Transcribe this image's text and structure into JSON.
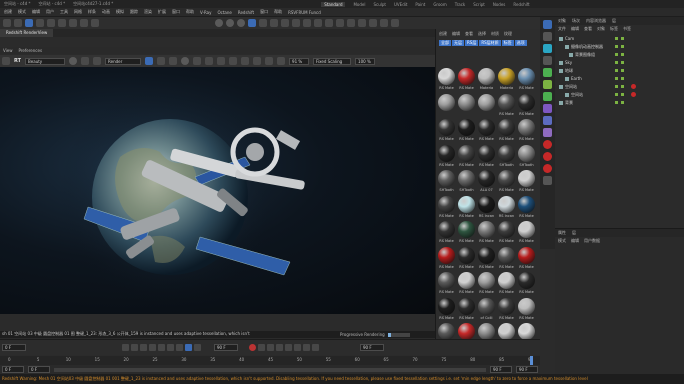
{
  "titlebar": {
    "tabs": [
      "空间站 - c4d *",
      "空间站 - c4d *",
      "空间站c4d27-1.c4d *"
    ],
    "active_layout": "Standard",
    "layouts": [
      "Model",
      "Sculpt",
      "UVEdit",
      "Paint",
      "Groom",
      "Track",
      "Script",
      "Nodes",
      "Redshift"
    ]
  },
  "menubar": {
    "items": [
      "创建",
      "模式",
      "编辑",
      "用户",
      "工具",
      "网格",
      "样条",
      "动画",
      "模拟",
      "跟踪",
      "渲染",
      "扩展",
      "窗口",
      "帮助",
      "V-Ray",
      "Octane",
      "Redshift",
      "窗口",
      "帮助",
      "RSVFRUM Funcd"
    ]
  },
  "panel_tab": {
    "label": "Redshift RenderView"
  },
  "view_menu": {
    "items": [
      "View",
      "Preferences"
    ]
  },
  "renderview": {
    "display_mode": "Beauty",
    "render_mode": "Render",
    "zoom": "91 %",
    "fit_mode": "Fixed Scaling",
    "zoom2": "100 %"
  },
  "log_line": "sh 01 空间站 03 中级 圆盘控制器 01 图 整键_1_23: 形态_3_6 公开体_159 is instanced and uses adaptive tessellation, which isn't",
  "progress": {
    "label": "Progressive Rendering",
    "value": 0.15
  },
  "timeline": {
    "start_frame": "0 F",
    "end_frame": "90 F",
    "current_frame": "90 F",
    "ticks": [
      "0",
      "5",
      "10",
      "15",
      "20",
      "25",
      "30",
      "35",
      "40",
      "45",
      "50",
      "55",
      "60",
      "65",
      "70",
      "75",
      "80",
      "85",
      "90"
    ],
    "field1": "0 F",
    "field2": "0 F",
    "field3": "90 F",
    "field4": "90 F"
  },
  "statusbar": "Redshift Warning: Mesh 01 空间站03 中级 圆盘控制器 01 001 整键_1_23 is instanced and uses adaptive tessellation, which isn't supported. Disabling tessellation. If you need tessellation, please use fixed tessellation settings i.e. set 'min edge length' to zero to force a maximum tessellation level",
  "materials": {
    "tabs": [
      "创建",
      "编辑",
      "查看",
      "选择",
      "材质",
      "纹理"
    ],
    "buttons": [
      "全部",
      "无层",
      "RS层",
      "RS层材质",
      "标签",
      "选项"
    ],
    "items": [
      {
        "label": "RS Mate",
        "color": "#d8d8d8"
      },
      {
        "label": "RS Mate",
        "color": "#c62828"
      },
      {
        "label": "Materia",
        "color": "#bdbdbd"
      },
      {
        "label": "Materia",
        "color": "#c9a227"
      },
      {
        "label": "RS Mate",
        "color": "#6a8fb0"
      },
      {
        "label": "",
        "color": "#9e9e9e"
      },
      {
        "label": "",
        "color": "#8d8d8d"
      },
      {
        "label": "",
        "color": "#a0a0a0"
      },
      {
        "label": "RS Mate",
        "color": "#555555"
      },
      {
        "label": "RS Mate",
        "color": "#2a2a2a"
      },
      {
        "label": "RS Mate",
        "color": "#333333"
      },
      {
        "label": "RS Mate",
        "color": "#1e1e1e"
      },
      {
        "label": "RS Mate",
        "color": "#2a2a2a"
      },
      {
        "label": "RS Mate",
        "color": "#3a3a3a"
      },
      {
        "label": "RS Mate",
        "color": "#7a7a7a"
      },
      {
        "label": "RS Mate",
        "color": "#252525"
      },
      {
        "label": "RS Mate",
        "color": "#444444"
      },
      {
        "label": "RS Mate",
        "color": "#2c2c2c"
      },
      {
        "label": "SHTooth",
        "color": "#3e3e3e"
      },
      {
        "label": "SHTooth",
        "color": "#8a8a8a"
      },
      {
        "label": "SHTooth",
        "color": "#5e5e5e"
      },
      {
        "label": "SHTooth",
        "color": "#6c6c6c"
      },
      {
        "label": "ALA 07",
        "color": "#262626"
      },
      {
        "label": "RS Mate",
        "color": "#4a4a4a"
      },
      {
        "label": "RS Mate",
        "color": "#d0d0d0"
      },
      {
        "label": "RS Mate",
        "color": "#444444"
      },
      {
        "label": "RS Mate",
        "color": "#bfe3e8"
      },
      {
        "label": "RS Incan",
        "color": "#1a1a1a"
      },
      {
        "label": "RS Incan",
        "color": "#cfd8dc"
      },
      {
        "label": "RS Mate",
        "color": "#1d4f7a"
      },
      {
        "label": "RS Mate",
        "color": "#333333"
      },
      {
        "label": "RS Mate",
        "color": "#2e5540"
      },
      {
        "label": "RS Mate",
        "color": "#7a7a7a"
      },
      {
        "label": "RS Mate",
        "color": "#3d3d3d"
      },
      {
        "label": "RS Mate",
        "color": "#cfcfcf"
      },
      {
        "label": "RS Mate",
        "color": "#b71c1c"
      },
      {
        "label": "RS Mate",
        "color": "#2a2a2a"
      },
      {
        "label": "RS Mate",
        "color": "#1f1f1f"
      },
      {
        "label": "RS Mate",
        "color": "#555555"
      },
      {
        "label": "RS Mate",
        "color": "#b71c1c"
      },
      {
        "label": "RS Mate",
        "color": "#5a5a5a"
      },
      {
        "label": "RS Mate",
        "color": "#d0d0d0"
      },
      {
        "label": "RS Mate",
        "color": "#9e9e9e"
      },
      {
        "label": "RS Mate",
        "color": "#cfcfcf"
      },
      {
        "label": "RS Mate",
        "color": "#2a2a2a"
      },
      {
        "label": "RS Mate",
        "color": "#1e1e1e"
      },
      {
        "label": "RS Mate",
        "color": "#2c2c2c"
      },
      {
        "label": "of Colli",
        "color": "#555555"
      },
      {
        "label": "RS Mate",
        "color": "#3a3a3a"
      },
      {
        "label": "RS Mate",
        "color": "#bdbdbd"
      },
      {
        "label": "",
        "color": "#5a5a5a"
      },
      {
        "label": "",
        "color": "#c62828"
      },
      {
        "label": "",
        "color": "#8d8d8d"
      },
      {
        "label": "",
        "color": "#cfcfcf"
      },
      {
        "label": "",
        "color": "#d8d8d8"
      }
    ]
  },
  "objects": {
    "tabs": [
      "对象",
      "场次",
      "内容浏览器",
      "层"
    ],
    "menu": [
      "文件",
      "编辑",
      "查看",
      "对象",
      "标签",
      "书签"
    ],
    "rows": [
      "Cam",
      "摄像机动画控制器",
      "背景图像组",
      "Sky",
      "地球",
      "Earth",
      "空间站",
      "空间站",
      "背景"
    ]
  },
  "attributes": {
    "tabs": [
      "属性",
      "层"
    ],
    "menu": [
      "模式",
      "编辑",
      "用户数据"
    ]
  },
  "colors": {
    "accent": "#3b6bb5",
    "warning": "#d48c2a",
    "tag_red": "#c62828"
  }
}
